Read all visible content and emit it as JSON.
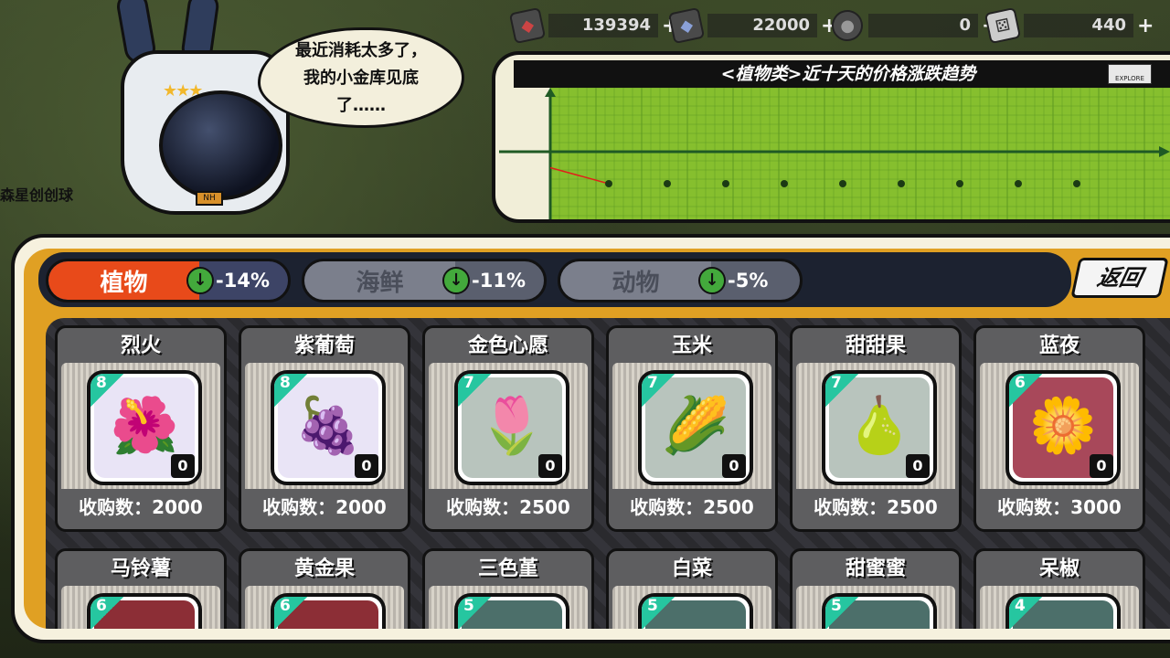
{
  "resources": [
    {
      "name": "red-gem-icon",
      "value": "139394",
      "color": "#b83b3b"
    },
    {
      "name": "blue-crystal-icon",
      "value": "22000",
      "color": "#4a5a8a"
    },
    {
      "name": "coin-icon",
      "value": "0",
      "color": "#555555"
    },
    {
      "name": "dice-icon",
      "value": "440",
      "color": "#cccccc"
    }
  ],
  "plus_label": "+",
  "background_text": "森星创创球",
  "mascot": {
    "badge": "NH",
    "speech": [
      "最近消耗太多了，",
      "我的小金库见底",
      "了……"
    ]
  },
  "chart_data": {
    "type": "line",
    "title": "<植物类>近十天的价格涨跌趋势",
    "logo": "EXPLORE",
    "x": [
      1,
      2,
      3,
      4,
      5,
      6,
      7,
      8,
      9,
      10
    ],
    "series": [
      {
        "values": [
          -14,
          -28,
          null,
          null,
          null,
          null,
          null,
          null,
          null,
          null
        ],
        "color": "#e0201a"
      }
    ],
    "marker_points": [
      2,
      3,
      4,
      5,
      6,
      7,
      8,
      9,
      10
    ],
    "grid": true,
    "bg_color": "#86bf2e"
  },
  "tabs": [
    {
      "label": "植物",
      "change": "-14%",
      "active": true
    },
    {
      "label": "海鲜",
      "change": "-11%",
      "active": false
    },
    {
      "label": "动物",
      "change": "-5%",
      "active": false
    }
  ],
  "back_label": "返回",
  "items": [
    {
      "name": "烈火",
      "level": "8",
      "qty": "0",
      "buy": "收购数：2000",
      "icon": "flower-icon",
      "glyph": "🌺",
      "bg": "#e9e4f6"
    },
    {
      "name": "紫葡萄",
      "level": "8",
      "qty": "0",
      "buy": "收购数：2000",
      "icon": "grape-icon",
      "glyph": "🍇",
      "bg": "#e9e4f6"
    },
    {
      "name": "金色心愿",
      "level": "7",
      "qty": "0",
      "buy": "收购数：2500",
      "icon": "tulip-icon",
      "glyph": "🌷",
      "bg": "#b8c4bd"
    },
    {
      "name": "玉米",
      "level": "7",
      "qty": "0",
      "buy": "收购数：2500",
      "icon": "corn-icon",
      "glyph": "🌽",
      "bg": "#b8c4bd"
    },
    {
      "name": "甜甜果",
      "level": "7",
      "qty": "0",
      "buy": "收购数：2500",
      "icon": "fruit-icon",
      "glyph": "🍐",
      "bg": "#b8c4bd"
    },
    {
      "name": "蓝夜",
      "level": "6",
      "qty": "0",
      "buy": "收购数：3000",
      "icon": "blue-flower-icon",
      "glyph": "🌼",
      "bg": "#a8485a"
    }
  ],
  "items_row2": [
    {
      "name": "马铃薯",
      "level": "6",
      "bg": "#8c2e36"
    },
    {
      "name": "黄金果",
      "level": "6",
      "bg": "#8c2e36"
    },
    {
      "name": "三色堇",
      "level": "5",
      "bg": "#4c6f6a"
    },
    {
      "name": "白菜",
      "level": "5",
      "bg": "#4c6f6a"
    },
    {
      "name": "甜蜜蜜",
      "level": "5",
      "bg": "#4c6f6a"
    },
    {
      "name": "呆椒",
      "level": "4",
      "bg": "#4c6f6a"
    }
  ]
}
